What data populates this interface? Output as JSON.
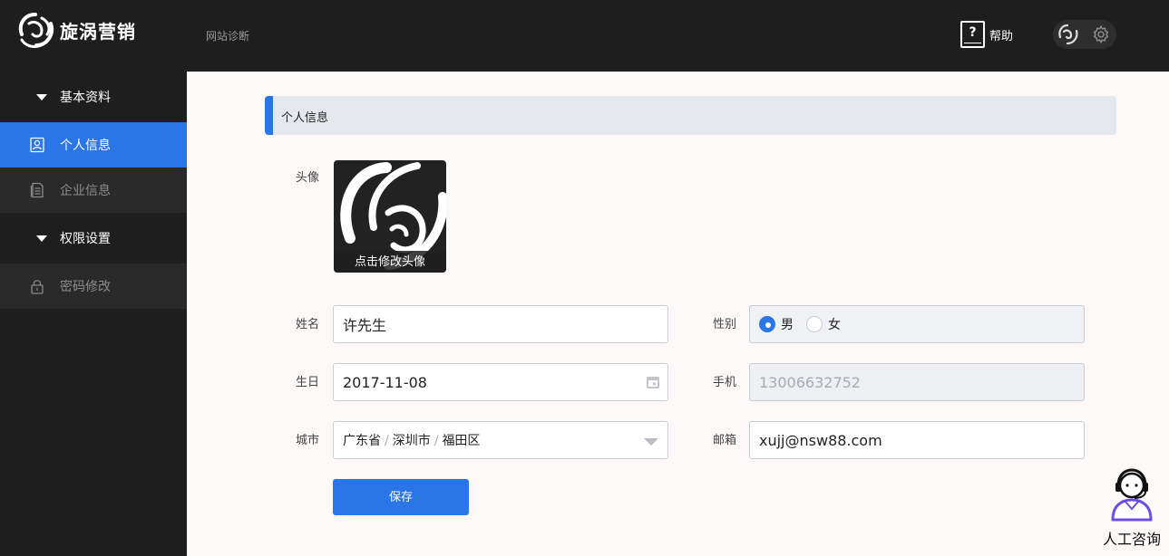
{
  "header": {
    "brand": "旋涡营销",
    "nav_link": "网站诊断",
    "help_label": "帮助",
    "help_symbol": "?"
  },
  "sidebar": {
    "groups": [
      {
        "label": "基本资料",
        "items": [
          {
            "label": "个人信息",
            "icon": "user-card-icon",
            "active": true
          },
          {
            "label": "企业信息",
            "icon": "document-icon",
            "active": false
          }
        ]
      },
      {
        "label": "权限设置",
        "items": [
          {
            "label": "密码修改",
            "icon": "lock-icon",
            "active": false
          }
        ]
      }
    ]
  },
  "main": {
    "section_title": "个人信息",
    "avatar_label": "头像",
    "avatar_caption": "点击修改头像",
    "name_label": "姓名",
    "name_value": "许先生",
    "gender_label": "性别",
    "gender_options": [
      "男",
      "女"
    ],
    "gender_selected": "男",
    "birthday_label": "生日",
    "birthday_value": "2017-11-08",
    "phone_label": "手机",
    "phone_value": "13006632752",
    "city_label": "城市",
    "city_parts": [
      "广东省",
      "深圳市",
      "福田区"
    ],
    "city_separator": "/",
    "email_label": "邮箱",
    "email_value": "xujj@nsw88.com",
    "save_label": "保存"
  },
  "consult": {
    "label": "人工咨询"
  },
  "colors": {
    "accent": "#2a75e8",
    "header_bg": "#1e1e1e",
    "main_bg": "#fbf8f7"
  }
}
